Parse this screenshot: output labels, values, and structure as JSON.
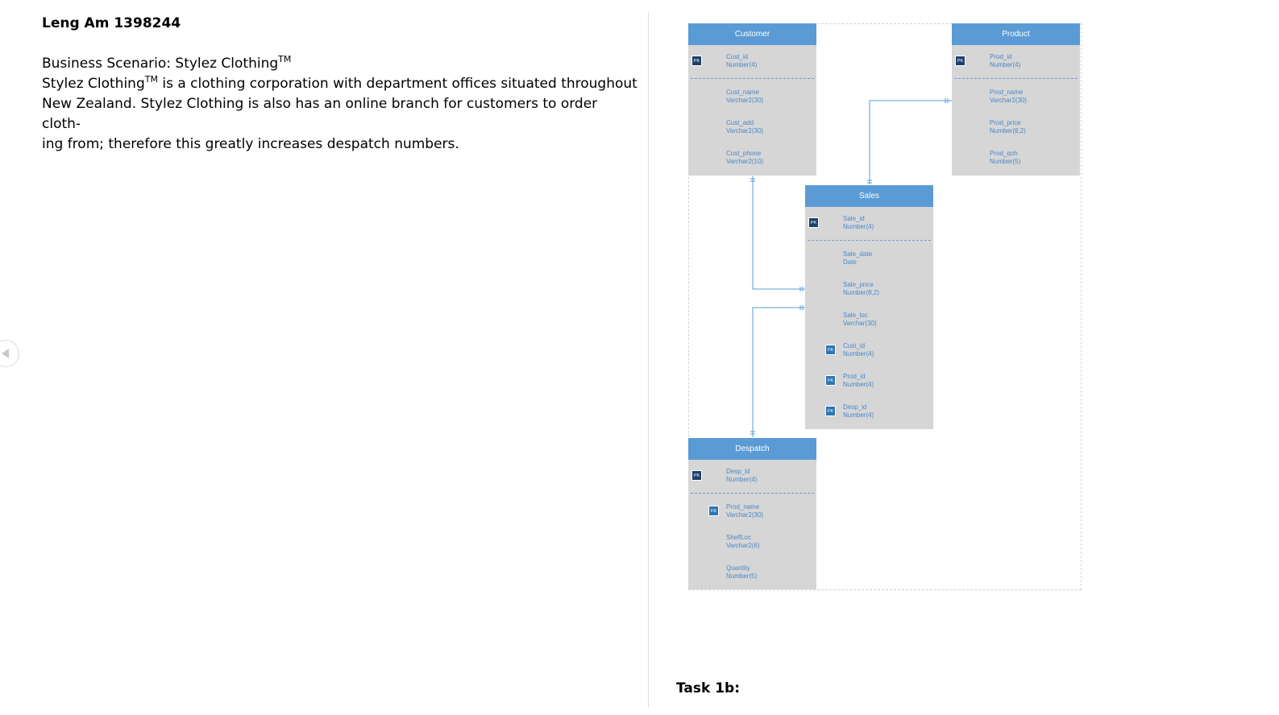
{
  "document": {
    "author_line": "Leng Am 1398244",
    "scenario_heading": "Business Scenario: Stylez Clothing",
    "trademark": "TM",
    "body_company": "Stylez Clothing",
    "body_line1_rest": " is a clothing corporation with department offices situated throughout",
    "body_line2": "New Zealand. Stylez Clothing is also has an online branch for customers to order cloth-",
    "body_line3": "ing from; therefore this greatly increases despatch numbers.",
    "task_label": "Task 1b:"
  },
  "erd": {
    "customer": {
      "title": "Customer",
      "attributes": [
        {
          "key": "PK",
          "name": "Cust_id",
          "type": "Number(4)"
        },
        {
          "key": "",
          "name": "Cust_name",
          "type": "Varchar2(30)"
        },
        {
          "key": "",
          "name": "Cust_add",
          "type": "Varchar2(30)"
        },
        {
          "key": "",
          "name": "Cust_phone",
          "type": "Varchar2(10)"
        }
      ]
    },
    "product": {
      "title": "Product",
      "attributes": [
        {
          "key": "PK",
          "name": "Prod_id",
          "type": "Number(4)"
        },
        {
          "key": "",
          "name": "Prod_name",
          "type": "Varchar2(30)"
        },
        {
          "key": "",
          "name": "Prod_price",
          "type": "Number(8,2)"
        },
        {
          "key": "",
          "name": "Prod_qoh",
          "type": "Number(5)"
        }
      ]
    },
    "sales": {
      "title": "Sales",
      "attributes": [
        {
          "key": "PK",
          "name": "Sale_id",
          "type": "Number(4)"
        },
        {
          "key": "",
          "name": "Sale_date",
          "type": "Date"
        },
        {
          "key": "",
          "name": "Sale_price",
          "type": "Number(8,2)"
        },
        {
          "key": "",
          "name": "Sale_loc",
          "type": "Varchar(30)"
        },
        {
          "key": "FK",
          "name": "Cust_id",
          "type": "Number(4)"
        },
        {
          "key": "FK",
          "name": "Prod_id",
          "type": "Number(4)"
        },
        {
          "key": "FK",
          "name": "Desp_id",
          "type": "Number(4)"
        }
      ]
    },
    "despatch": {
      "title": "Despatch",
      "attributes": [
        {
          "key": "PK",
          "name": "Desp_id",
          "type": "Number(4)"
        },
        {
          "key": "FK",
          "name": "Prod_name",
          "type": "Varchar2(30)"
        },
        {
          "key": "",
          "name": "ShelfLoc",
          "type": "Varchar2(6)"
        },
        {
          "key": "",
          "name": "Quantity",
          "type": "Number(5)"
        }
      ]
    }
  },
  "colors": {
    "entity_header": "#5b9bd5",
    "entity_body": "#d6d6d6",
    "attribute_text": "#4a86c8",
    "primary_key_badge": "#1f3f6b",
    "foreign_key_badge": "#2e75b6",
    "connector": "#5b9bd5"
  },
  "icons": {
    "previous_page": "chevron-left-icon"
  }
}
